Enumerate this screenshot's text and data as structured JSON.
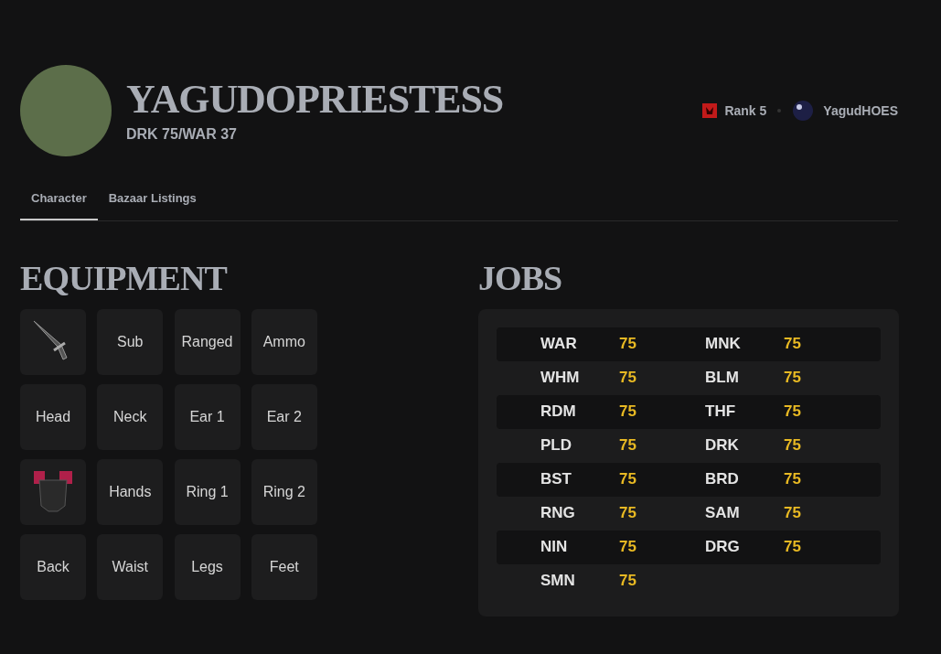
{
  "profile": {
    "name": "YAGUDOPRIESTESS",
    "jobs_line": "DRK 75/WAR 37",
    "rank": "Rank 5",
    "linkshell": "YagudHOES"
  },
  "tabs": [
    {
      "label": "Character",
      "selected": true
    },
    {
      "label": "Bazaar Listings",
      "selected": false
    }
  ],
  "equipment": {
    "title": "EQUIPMENT",
    "slots": [
      {
        "kind": "weapon"
      },
      {
        "kind": "empty",
        "label": "Sub"
      },
      {
        "kind": "empty",
        "label": "Ranged"
      },
      {
        "kind": "empty",
        "label": "Ammo"
      },
      {
        "kind": "empty",
        "label": "Head"
      },
      {
        "kind": "empty",
        "label": "Neck"
      },
      {
        "kind": "empty",
        "label": "Ear 1"
      },
      {
        "kind": "empty",
        "label": "Ear 2"
      },
      {
        "kind": "armor"
      },
      {
        "kind": "empty",
        "label": "Hands"
      },
      {
        "kind": "empty",
        "label": "Ring 1"
      },
      {
        "kind": "empty",
        "label": "Ring 2"
      },
      {
        "kind": "empty",
        "label": "Back"
      },
      {
        "kind": "empty",
        "label": "Waist"
      },
      {
        "kind": "empty",
        "label": "Legs"
      },
      {
        "kind": "empty",
        "label": "Feet"
      }
    ]
  },
  "jobs": {
    "title": "JOBS",
    "list": [
      {
        "name": "WAR",
        "level": "75"
      },
      {
        "name": "MNK",
        "level": "75"
      },
      {
        "name": "WHM",
        "level": "75"
      },
      {
        "name": "BLM",
        "level": "75"
      },
      {
        "name": "RDM",
        "level": "75"
      },
      {
        "name": "THF",
        "level": "75"
      },
      {
        "name": "PLD",
        "level": "75"
      },
      {
        "name": "DRK",
        "level": "75"
      },
      {
        "name": "BST",
        "level": "75"
      },
      {
        "name": "BRD",
        "level": "75"
      },
      {
        "name": "RNG",
        "level": "75"
      },
      {
        "name": "SAM",
        "level": "75"
      },
      {
        "name": "NIN",
        "level": "75"
      },
      {
        "name": "DRG",
        "level": "75"
      },
      {
        "name": "SMN",
        "level": "75"
      }
    ]
  }
}
